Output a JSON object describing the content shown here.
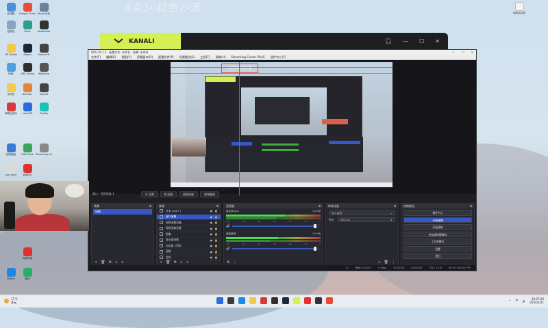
{
  "overlay_title": "8点30红色沙漠",
  "kanali": {
    "brand": "KANALI",
    "controls": [
      "🎧",
      "—",
      "☐",
      "✕"
    ]
  },
  "desktop_icons": [
    {
      "label": "此电脑",
      "color": "#4a90d9"
    },
    {
      "label": "Google Chrome",
      "color": "#e84b3c"
    },
    {
      "label": "Steam社区",
      "color": "#6b8299"
    },
    {
      "label": "回收站",
      "color": "#8aa5c4"
    },
    {
      "label": "Voice",
      "color": "#2a9d8f"
    },
    {
      "label": "Streamlab",
      "color": "#333"
    },
    {
      "label": "UP Studio",
      "color": "#f2c94c"
    },
    {
      "label": "Steam",
      "color": "#1b2838"
    },
    {
      "label": "SteamVR",
      "color": "#444"
    },
    {
      "label": "网络",
      "color": "#4aa3df"
    },
    {
      "label": "OBS Studio",
      "color": "#302e31"
    },
    {
      "label": "WeGame",
      "color": "#555"
    },
    {
      "label": "文件夹",
      "color": "#f2c94c"
    },
    {
      "label": "Blender",
      "color": "#e8833a"
    },
    {
      "label": "ShareX",
      "color": "#444"
    },
    {
      "label": "网易云音乐",
      "color": "#d63a3a"
    },
    {
      "label": "LetsVPN",
      "color": "#2d6cdf"
    },
    {
      "label": "TapTap",
      "color": "#19c1b6"
    },
    {
      "label": "控制面板",
      "color": "#3a7bd5"
    },
    {
      "label": "USB Kiosk",
      "color": "#3aa55c"
    },
    {
      "label": "Streaming Center",
      "color": "#888"
    },
    {
      "label": "hue_sync",
      "color": "#d9d9d9"
    },
    {
      "label": "网易UU",
      "color": "#e03131"
    },
    {
      "label": "Arsenal",
      "color": "#2d6cdf"
    },
    {
      "label": "猿搜",
      "color": "#e03131"
    },
    {
      "label": "Navicat",
      "color": "#e8a33a"
    },
    {
      "label": "网易有道",
      "color": "#e03131"
    },
    {
      "label": "Mstore",
      "color": "#1e88e5"
    },
    {
      "label": "微信",
      "color": "#2aae67"
    }
  ],
  "recycle_bin_right": {
    "label": "回收站文档"
  },
  "obs": {
    "title": "OBS 29.1.2 - 配置文件: 未命名 - 场景: 未命名",
    "menu": [
      "文件(F)",
      "编辑(E)",
      "视图(V)",
      "停靠窗口(D)",
      "配置文件(P)",
      "场景集合(S)",
      "工具(T)",
      "帮助(H)",
      "Streaming Center PLUG",
      "插件中心(C)"
    ],
    "title_controls": [
      "—",
      "☐",
      "✕"
    ],
    "preview_overlay_text": "8点30红色沙漠",
    "scene_toolbar": {
      "source_name": "窗口 · 视频采集 1",
      "buttons": [
        "⚙ 设置",
        "⧉ 滤镜",
        "视频采集",
        "视频截图"
      ]
    },
    "docks": {
      "scenes": {
        "title": "场景",
        "items": [
          "场景"
        ],
        "footer": [
          "+",
          "🗑",
          "⚙",
          "∧",
          "∨"
        ]
      },
      "sources": {
        "title": "来源",
        "items": [
          {
            "label": "文本 (GDI+)",
            "selected": false
          },
          {
            "label": "窗口采集",
            "selected": true
          },
          {
            "label": "视频采集设备",
            "selected": false
          },
          {
            "label": "视频采集设备",
            "selected": false
          },
          {
            "label": "图像",
            "selected": false
          },
          {
            "label": "显示器采集",
            "selected": false
          },
          {
            "label": "浏览器 (代理)",
            "selected": false
          },
          {
            "label": "图像",
            "selected": false
          },
          {
            "label": "音频",
            "selected": false
          }
        ],
        "footer": [
          "+",
          "🗑",
          "⚙",
          "∧",
          "∨"
        ]
      },
      "mixer": {
        "title": "混音器",
        "channels": [
          {
            "name": "麦克风/Aux",
            "db": "0.0 dB",
            "level": 0.62
          },
          {
            "name": "桌面音频",
            "db": "0.0 dB",
            "level": 0.55
          }
        ],
        "ticks": [
          "-60",
          "-50",
          "-40",
          "-30",
          "-20",
          "-10",
          "0"
        ],
        "footer": [
          "⚙",
          "⋮"
        ]
      },
      "transitions": {
        "title": "转场动画",
        "transition": "淡入淡出",
        "duration_label": "时长",
        "duration_value": "300 ms",
        "footer": [
          "+",
          "🗑",
          "⋮"
        ]
      },
      "controls": {
        "title": "控制按钮",
        "buttons": [
          {
            "label": "插件中心",
            "active": false
          },
          {
            "label": "开始直播",
            "active": true
          },
          {
            "label": "开始录制",
            "active": false
          },
          {
            "label": "启动虚拟摄像机",
            "active": false
          },
          {
            "label": "工作室模式",
            "active": false
          },
          {
            "label": "设置",
            "active": false
          },
          {
            "label": "退出",
            "active": false
          }
        ]
      }
    },
    "statusbar": [
      "⊘",
      "丢帧 0 (0.0%)",
      "0 kbps",
      "00:00:00",
      "00:00:00",
      "CPU: 1.1%",
      "60.00 / 60.00 FPS"
    ]
  },
  "taskbar": {
    "weather_temp": "17°C",
    "weather_desc": "多云",
    "icons": [
      {
        "name": "windows",
        "color": "#2d6cdf"
      },
      {
        "name": "search",
        "color": "#3a3a3a"
      },
      {
        "name": "taskview",
        "color": "#1e88e5"
      },
      {
        "name": "explorer",
        "color": "#f2c94c"
      },
      {
        "name": "netease",
        "color": "#d63a3a"
      },
      {
        "name": "obs",
        "color": "#302e31"
      },
      {
        "name": "steam",
        "color": "#1b2838"
      },
      {
        "name": "kanali",
        "color": "#d6ef52"
      },
      {
        "name": "music",
        "color": "#e03131"
      },
      {
        "name": "game",
        "color": "#333"
      },
      {
        "name": "voice",
        "color": "#e84b3c"
      }
    ],
    "time": "16:27:00",
    "date": "2024/2/21",
    "tray": [
      "^",
      "中",
      "🔊"
    ]
  }
}
